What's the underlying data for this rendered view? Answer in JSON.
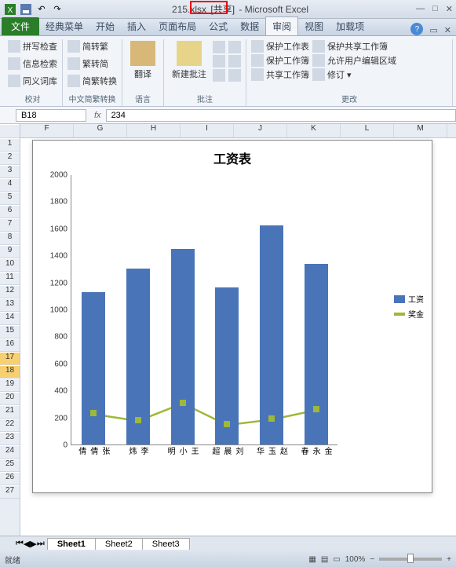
{
  "title": {
    "filename": "215.xlsx",
    "shared": "[共享]",
    "app": "- Microsoft Excel"
  },
  "tabs": {
    "file": "文件",
    "items": [
      "经典菜单",
      "开始",
      "插入",
      "页面布局",
      "公式",
      "数据",
      "审阅",
      "视图",
      "加载项"
    ],
    "active": 6
  },
  "ribbon": {
    "proof": {
      "spell": "拼写检查",
      "research": "信息检索",
      "thesaurus": "同义词库",
      "label": "校对"
    },
    "chinese": {
      "s2t": "简转繁",
      "t2s": "繁转简",
      "conv": "简繁转换",
      "label": "中文简繁转换"
    },
    "lang": {
      "translate": "翻译",
      "label": "语言"
    },
    "comments": {
      "new": "新建批注",
      "label": "批注"
    },
    "changes": {
      "protect_sheet": "保护工作表",
      "protect_book": "保护工作簿",
      "share_book": "共享工作簿",
      "pshare": "保护共享工作簿",
      "allow_edit": "允许用户编辑区域",
      "track": "修订",
      "label": "更改"
    }
  },
  "namebox": "B18",
  "formula": "234",
  "cols": [
    "F",
    "G",
    "H",
    "I",
    "J",
    "K",
    "L",
    "M"
  ],
  "rows_visible": 27,
  "selected_row": 18,
  "marked_row": 17,
  "chart_data": {
    "type": "bar",
    "title": "工资表",
    "categories": [
      "张倩倩",
      "李炜",
      "王小明",
      "刘晨超",
      "赵玉华",
      "金永春"
    ],
    "series": [
      {
        "name": "工资",
        "type": "bar",
        "values": [
          1130,
          1300,
          1450,
          1160,
          1620,
          1340
        ],
        "color": "#4a74b8"
      },
      {
        "name": "奖金",
        "type": "line",
        "values": [
          230,
          180,
          310,
          150,
          190,
          260
        ],
        "color": "#9eb838"
      }
    ],
    "ylim": [
      0,
      2000
    ],
    "ystep": 200
  },
  "sheet_tabs": [
    "Sheet1",
    "Sheet2",
    "Sheet3"
  ],
  "status": {
    "ready": "就绪",
    "zoom": "100%"
  }
}
